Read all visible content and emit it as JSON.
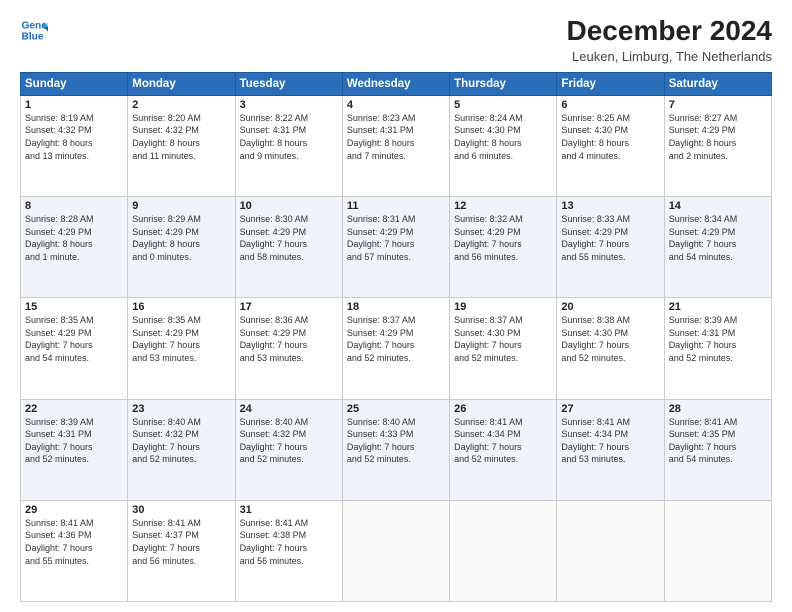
{
  "header": {
    "logo_line1": "General",
    "logo_line2": "Blue",
    "main_title": "December 2024",
    "subtitle": "Leuken, Limburg, The Netherlands"
  },
  "days_of_week": [
    "Sunday",
    "Monday",
    "Tuesday",
    "Wednesday",
    "Thursday",
    "Friday",
    "Saturday"
  ],
  "weeks": [
    [
      {
        "day": "1",
        "info": "Sunrise: 8:19 AM\nSunset: 4:32 PM\nDaylight: 8 hours\nand 13 minutes."
      },
      {
        "day": "2",
        "info": "Sunrise: 8:20 AM\nSunset: 4:32 PM\nDaylight: 8 hours\nand 11 minutes."
      },
      {
        "day": "3",
        "info": "Sunrise: 8:22 AM\nSunset: 4:31 PM\nDaylight: 8 hours\nand 9 minutes."
      },
      {
        "day": "4",
        "info": "Sunrise: 8:23 AM\nSunset: 4:31 PM\nDaylight: 8 hours\nand 7 minutes."
      },
      {
        "day": "5",
        "info": "Sunrise: 8:24 AM\nSunset: 4:30 PM\nDaylight: 8 hours\nand 6 minutes."
      },
      {
        "day": "6",
        "info": "Sunrise: 8:25 AM\nSunset: 4:30 PM\nDaylight: 8 hours\nand 4 minutes."
      },
      {
        "day": "7",
        "info": "Sunrise: 8:27 AM\nSunset: 4:29 PM\nDaylight: 8 hours\nand 2 minutes."
      }
    ],
    [
      {
        "day": "8",
        "info": "Sunrise: 8:28 AM\nSunset: 4:29 PM\nDaylight: 8 hours\nand 1 minute."
      },
      {
        "day": "9",
        "info": "Sunrise: 8:29 AM\nSunset: 4:29 PM\nDaylight: 8 hours\nand 0 minutes."
      },
      {
        "day": "10",
        "info": "Sunrise: 8:30 AM\nSunset: 4:29 PM\nDaylight: 7 hours\nand 58 minutes."
      },
      {
        "day": "11",
        "info": "Sunrise: 8:31 AM\nSunset: 4:29 PM\nDaylight: 7 hours\nand 57 minutes."
      },
      {
        "day": "12",
        "info": "Sunrise: 8:32 AM\nSunset: 4:29 PM\nDaylight: 7 hours\nand 56 minutes."
      },
      {
        "day": "13",
        "info": "Sunrise: 8:33 AM\nSunset: 4:29 PM\nDaylight: 7 hours\nand 55 minutes."
      },
      {
        "day": "14",
        "info": "Sunrise: 8:34 AM\nSunset: 4:29 PM\nDaylight: 7 hours\nand 54 minutes."
      }
    ],
    [
      {
        "day": "15",
        "info": "Sunrise: 8:35 AM\nSunset: 4:29 PM\nDaylight: 7 hours\nand 54 minutes."
      },
      {
        "day": "16",
        "info": "Sunrise: 8:35 AM\nSunset: 4:29 PM\nDaylight: 7 hours\nand 53 minutes."
      },
      {
        "day": "17",
        "info": "Sunrise: 8:36 AM\nSunset: 4:29 PM\nDaylight: 7 hours\nand 53 minutes."
      },
      {
        "day": "18",
        "info": "Sunrise: 8:37 AM\nSunset: 4:29 PM\nDaylight: 7 hours\nand 52 minutes."
      },
      {
        "day": "19",
        "info": "Sunrise: 8:37 AM\nSunset: 4:30 PM\nDaylight: 7 hours\nand 52 minutes."
      },
      {
        "day": "20",
        "info": "Sunrise: 8:38 AM\nSunset: 4:30 PM\nDaylight: 7 hours\nand 52 minutes."
      },
      {
        "day": "21",
        "info": "Sunrise: 8:39 AM\nSunset: 4:31 PM\nDaylight: 7 hours\nand 52 minutes."
      }
    ],
    [
      {
        "day": "22",
        "info": "Sunrise: 8:39 AM\nSunset: 4:31 PM\nDaylight: 7 hours\nand 52 minutes."
      },
      {
        "day": "23",
        "info": "Sunrise: 8:40 AM\nSunset: 4:32 PM\nDaylight: 7 hours\nand 52 minutes."
      },
      {
        "day": "24",
        "info": "Sunrise: 8:40 AM\nSunset: 4:32 PM\nDaylight: 7 hours\nand 52 minutes."
      },
      {
        "day": "25",
        "info": "Sunrise: 8:40 AM\nSunset: 4:33 PM\nDaylight: 7 hours\nand 52 minutes."
      },
      {
        "day": "26",
        "info": "Sunrise: 8:41 AM\nSunset: 4:34 PM\nDaylight: 7 hours\nand 52 minutes."
      },
      {
        "day": "27",
        "info": "Sunrise: 8:41 AM\nSunset: 4:34 PM\nDaylight: 7 hours\nand 53 minutes."
      },
      {
        "day": "28",
        "info": "Sunrise: 8:41 AM\nSunset: 4:35 PM\nDaylight: 7 hours\nand 54 minutes."
      }
    ],
    [
      {
        "day": "29",
        "info": "Sunrise: 8:41 AM\nSunset: 4:36 PM\nDaylight: 7 hours\nand 55 minutes."
      },
      {
        "day": "30",
        "info": "Sunrise: 8:41 AM\nSunset: 4:37 PM\nDaylight: 7 hours\nand 56 minutes."
      },
      {
        "day": "31",
        "info": "Sunrise: 8:41 AM\nSunset: 4:38 PM\nDaylight: 7 hours\nand 56 minutes."
      },
      {
        "day": "",
        "info": ""
      },
      {
        "day": "",
        "info": ""
      },
      {
        "day": "",
        "info": ""
      },
      {
        "day": "",
        "info": ""
      }
    ]
  ]
}
